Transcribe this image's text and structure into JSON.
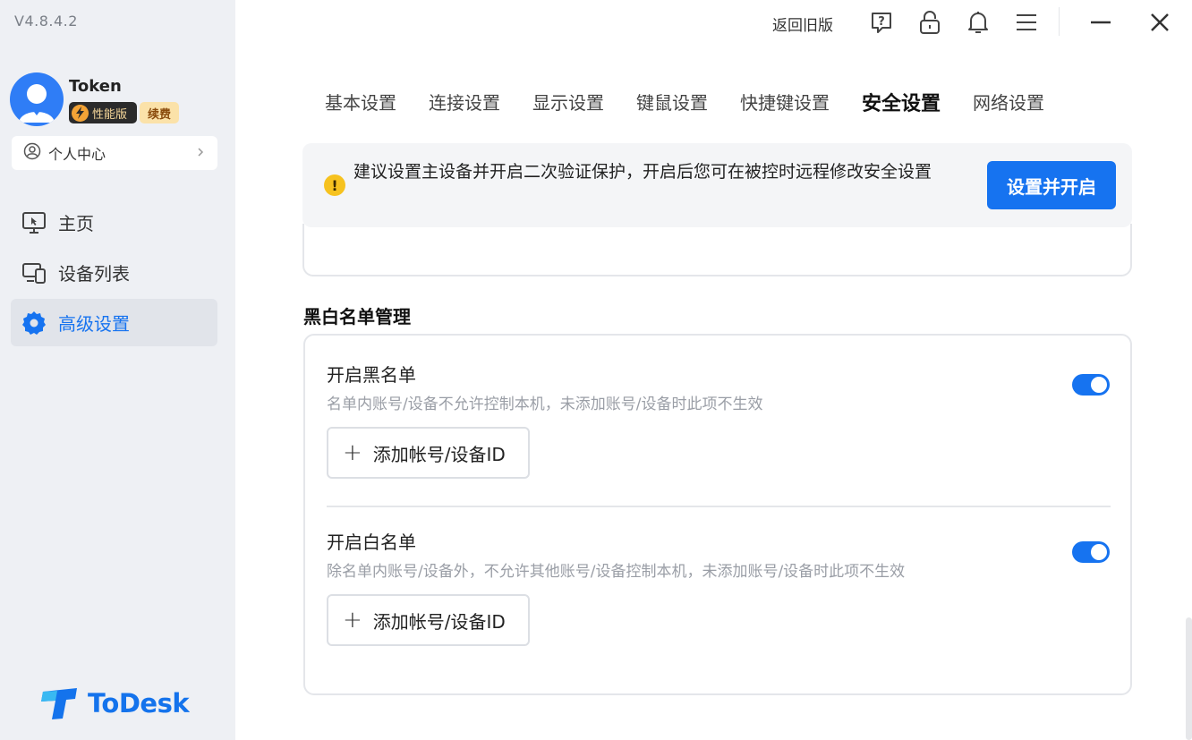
{
  "app": {
    "version": "V4.8.4.2",
    "logo_text": "ToDesk"
  },
  "user": {
    "name": "Token",
    "tier_label": "性能版",
    "renew_label": "续费"
  },
  "sidebar": {
    "personal_center": "个人中心",
    "items": [
      {
        "label": "主页",
        "icon": "monitor-icon",
        "active": false
      },
      {
        "label": "设备列表",
        "icon": "devices-icon",
        "active": false
      },
      {
        "label": "高级设置",
        "icon": "gear-icon",
        "active": true
      }
    ]
  },
  "topbar": {
    "back_old_label": "返回旧版",
    "icons": [
      "help-icon",
      "lock-icon",
      "bell-icon",
      "menu-icon",
      "minimize-icon",
      "close-icon"
    ]
  },
  "tabs": [
    {
      "label": "基本设置",
      "active": false
    },
    {
      "label": "连接设置",
      "active": false
    },
    {
      "label": "显示设置",
      "active": false
    },
    {
      "label": "键鼠设置",
      "active": false
    },
    {
      "label": "快捷键设置",
      "active": false
    },
    {
      "label": "安全设置",
      "active": true
    },
    {
      "label": "网络设置",
      "active": false
    }
  ],
  "notice": {
    "text": "建议设置主设备并开启二次验证保护，开启后您可在被控时远程修改安全设置",
    "button_label": "设置并开启"
  },
  "blacklist_section": {
    "title": "黑白名单管理",
    "blacklist": {
      "title": "开启黑名单",
      "description": "名单内账号/设备不允许控制本机，未添加账号/设备时此项不生效",
      "enabled": true,
      "add_label": "添加帐号/设备ID"
    },
    "whitelist": {
      "title": "开启白名单",
      "description": "除名单内账号/设备外，不允许其他账号/设备控制本机，未添加账号/设备时此项不生效",
      "enabled": true,
      "add_label": "添加帐号/设备ID"
    }
  },
  "colors": {
    "accent": "#1673f0",
    "sidebar_bg": "#eef0f4",
    "warning": "#f6c21f"
  }
}
